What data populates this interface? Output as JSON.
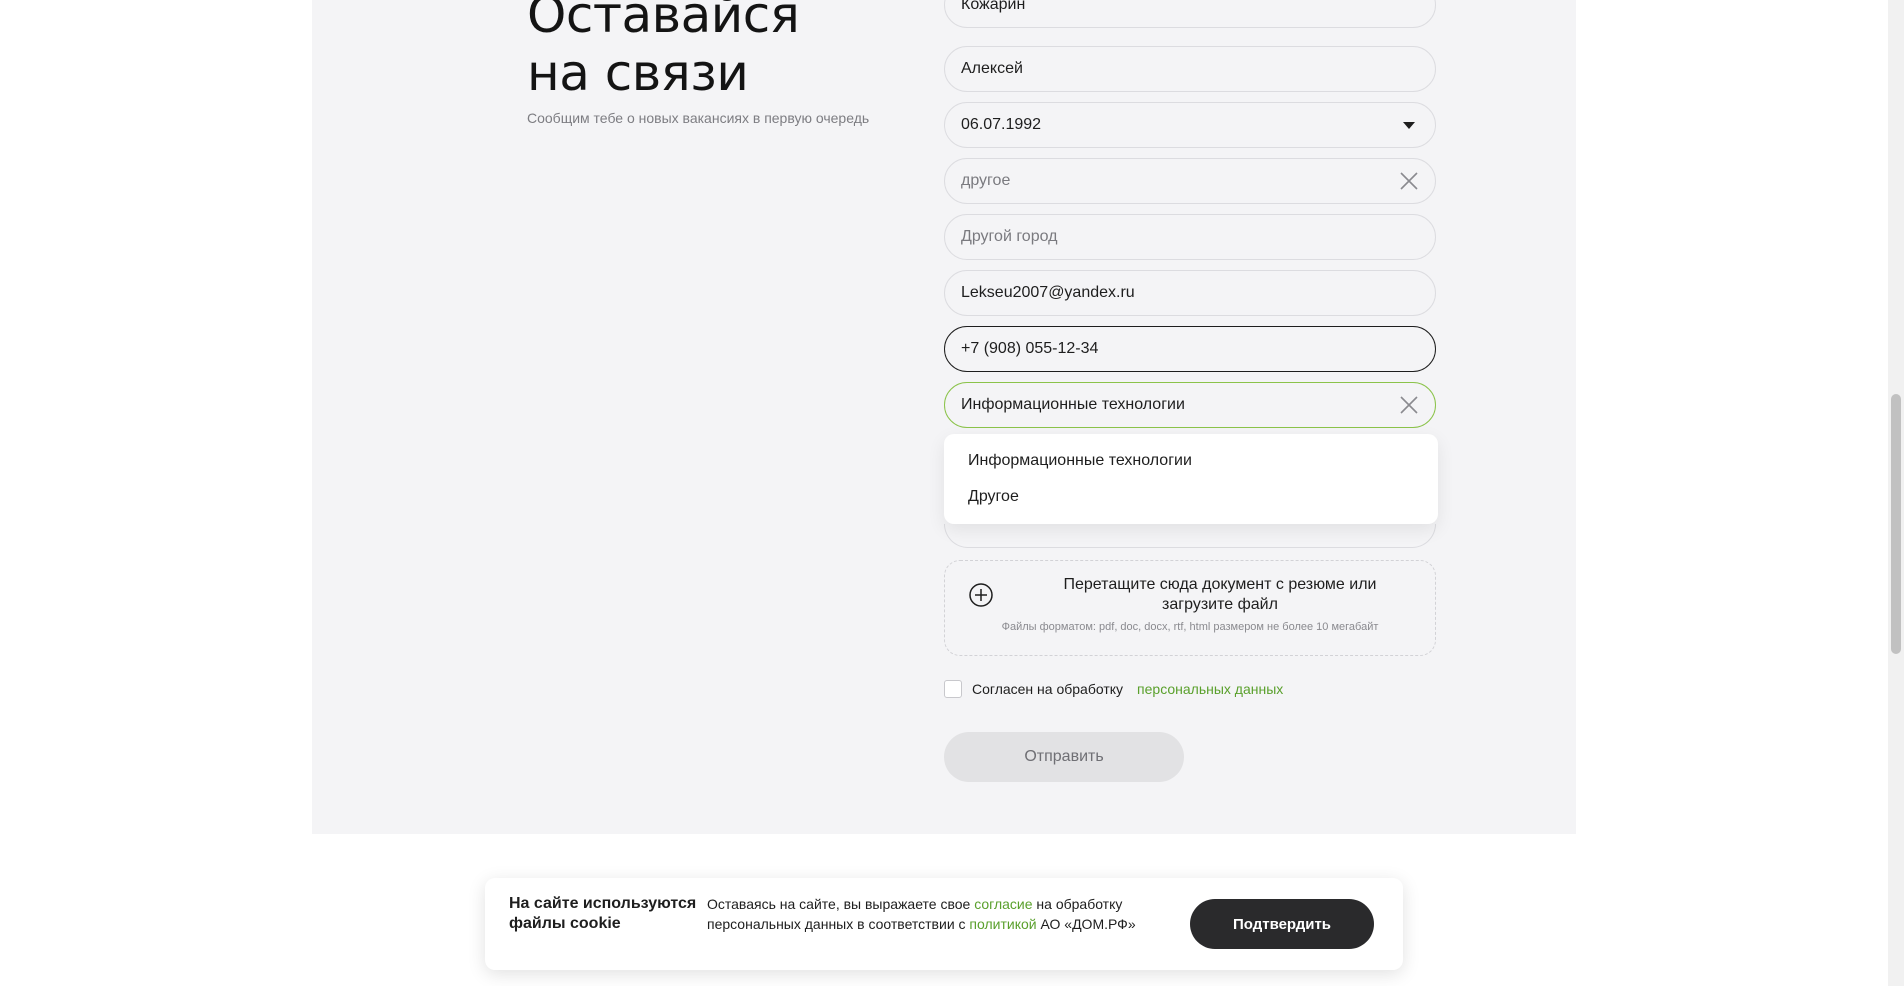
{
  "heading": {
    "line1": "Оставайся",
    "line2": "на связи"
  },
  "subtitle": "Сообщим тебе о новых вакансиях в первую очередь",
  "form": {
    "surname": "Кожарин",
    "name": "Алексей",
    "birthdate": "06.07.1992",
    "city_select": "другое",
    "other_city_placeholder": "Другой город",
    "email": "Lekseu2007@yandex.ru",
    "phone": "+7 (908) 055-12-34",
    "direction": "Информационные технологии"
  },
  "dropdown": {
    "options": [
      "Информационные технологии",
      "Другое"
    ]
  },
  "upload": {
    "title": "Перетащите сюда документ с резюме или загрузите файл",
    "hint": "Файлы форматом: pdf, doc, docx, rtf, html размером не более 10 мегабайт"
  },
  "consent": {
    "text": "Согласен на обработку",
    "link": "персональных данных"
  },
  "submit_label": "Отправить",
  "cookie": {
    "title": "На сайте используются файлы cookie",
    "text_before": "Оставаясь на сайте, вы выражаете свое ",
    "link1": "согласие",
    "text_middle": " на обработку персональных данных в соответствии с ",
    "link2": "политикой",
    "text_after": " АО «ДОМ.РФ»",
    "confirm_label": "Подтвердить"
  },
  "colors": {
    "accent_green": "#5aa02c",
    "focus_green": "#8bc34a",
    "panel_bg": "#f4f4f6",
    "dark_button": "#2a2a2c"
  }
}
